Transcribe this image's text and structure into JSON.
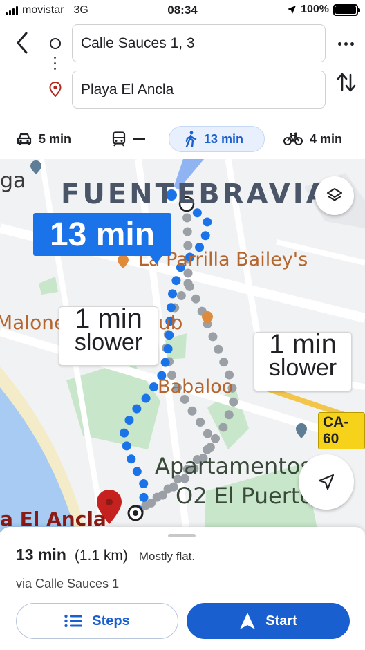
{
  "status_bar": {
    "carrier": "movistar",
    "network": "3G",
    "time": "08:34",
    "battery": "100%"
  },
  "search": {
    "origin": "Calle Sauces 1, 3",
    "destination": "Playa El Ancla"
  },
  "modes": [
    {
      "mode": "car",
      "icon": "car-icon",
      "label": "5 min"
    },
    {
      "mode": "transit",
      "icon": "transit-icon",
      "label": ""
    },
    {
      "mode": "walk",
      "icon": "walk-icon",
      "label": "13 min",
      "selected": true
    },
    {
      "mode": "bike",
      "icon": "bike-icon",
      "label": "4 min"
    }
  ],
  "map": {
    "labels": {
      "neighborhood": "FUENTEBRAVIA",
      "edge_left": "ga",
      "poi_parrilla": "La Parrilla Bailey's",
      "poi_malone": "Malone Pub & Grub",
      "poi_babaloo": "Babaloo",
      "poi_apartamentos_1": "Apartamentos",
      "poi_apartamentos_2": "O2 El Puerto",
      "destination_label": "a El Ancla",
      "road_badge": "CA-60"
    },
    "route_badge": "13 min",
    "alt_routes": [
      {
        "line1": "1 min",
        "line2": "slower"
      },
      {
        "line1": "1 min",
        "line2": "slower"
      }
    ],
    "colors": {
      "route_primary": "#1a73e8",
      "route_alt": "#9aa0a6",
      "park": "#c8e6c9",
      "water": "#a7cbf2",
      "poi": "#b5662f"
    }
  },
  "sheet": {
    "duration": "13 min",
    "distance": "(1.1 km)",
    "terrain": "Mostly flat.",
    "via": "via Calle Sauces 1",
    "steps_label": "Steps",
    "start_label": "Start"
  }
}
